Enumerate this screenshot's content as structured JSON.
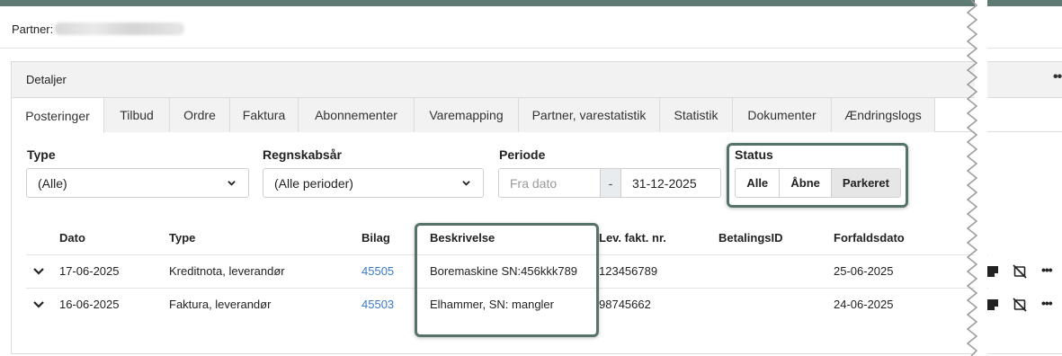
{
  "partner": {
    "label": "Partner:"
  },
  "card": {
    "title": "Detaljer",
    "menu_icon": "more-dots-icon"
  },
  "tabs": [
    {
      "label": "Posteringer",
      "active": true
    },
    {
      "label": "Tilbud"
    },
    {
      "label": "Ordre"
    },
    {
      "label": "Faktura"
    },
    {
      "label": "Abonnementer"
    },
    {
      "label": "Varemapping"
    },
    {
      "label": "Partner, varestatistik"
    },
    {
      "label": "Statistik"
    },
    {
      "label": "Dokumenter"
    },
    {
      "label": "Ændringslogs"
    }
  ],
  "filters": {
    "type": {
      "label": "Type",
      "value": "(Alle)"
    },
    "year": {
      "label": "Regnskabsår",
      "value": "(Alle perioder)"
    },
    "period": {
      "label": "Periode",
      "from_placeholder": "Fra dato",
      "separator": "-",
      "to_value": "31-12-2025"
    },
    "status": {
      "label": "Status",
      "options": [
        "Alle",
        "Åbne",
        "Parkeret"
      ],
      "selected": "Parkeret"
    }
  },
  "table": {
    "columns": [
      "Dato",
      "Type",
      "Bilag",
      "Beskrivelse",
      "Lev. fakt. nr.",
      "BetalingsID",
      "Forfaldsdato"
    ],
    "rows": [
      {
        "dato": "17-06-2025",
        "type": "Kreditnota, leverandør",
        "bilag": "45505",
        "beskrivelse": "Boremaskine SN:456kkk789",
        "lev": "123456789",
        "betalingsid": "",
        "forfald": "25-06-2025"
      },
      {
        "dato": "16-06-2025",
        "type": "Faktura, leverandør",
        "bilag": "45503",
        "beskrivelse": "Elhammer, SN: mangler",
        "lev": "98745662",
        "betalingsid": "",
        "forfald": "24-06-2025"
      }
    ]
  },
  "colors": {
    "topbar": "#5f7a73",
    "highlight": "#557368",
    "link": "#3b78c9"
  }
}
